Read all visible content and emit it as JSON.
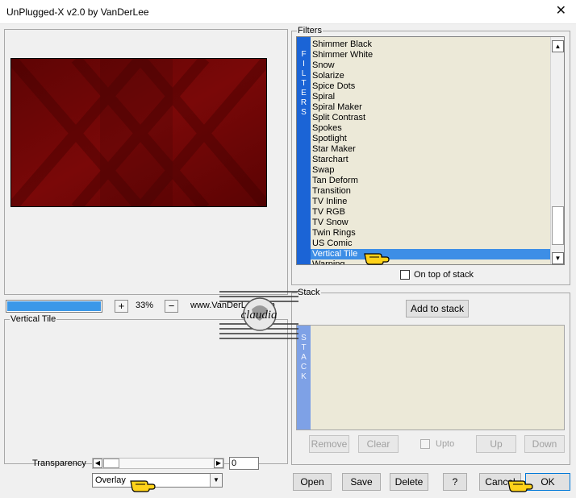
{
  "window": {
    "title": "UnPlugged-X v2.0 by VanDerLee",
    "close_glyph": "✕"
  },
  "preview": {
    "progress_percent": 100
  },
  "zoom": {
    "minus": "−",
    "plus": "+",
    "value": "33%"
  },
  "website": "www.VanDerLee.com",
  "filters": {
    "group_label": "Filters",
    "tab_text": "FILTERS",
    "items": [
      "Shimmer Black",
      "Shimmer White",
      "Snow",
      "Solarize",
      "Spice Dots",
      "Spiral",
      "Spiral Maker",
      "Split Contrast",
      "Spokes",
      "Spotlight",
      "Star Maker",
      "Starchart",
      "Swap",
      "Tan Deform",
      "Transition",
      "TV Inline",
      "TV RGB",
      "TV Snow",
      "Twin Rings",
      "US Comic",
      "Vertical Tile",
      "Warping"
    ],
    "selected_index": 20,
    "scroll_up_glyph": "▲",
    "scroll_down_glyph": "▼",
    "on_top_label": "On top of stack"
  },
  "settings": {
    "group_label": "Vertical Tile"
  },
  "stack": {
    "group_label": "Stack",
    "tab_text": "STACK",
    "add_button": "Add to stack",
    "remove": "Remove",
    "clear": "Clear",
    "upto": "Upto",
    "up": "Up",
    "down": "Down"
  },
  "transparency": {
    "label": "Transparency",
    "value": "0",
    "left_glyph": "◀",
    "right_glyph": "▶"
  },
  "blend": {
    "selected": "Overlay",
    "arrow_glyph": "▼"
  },
  "footer": {
    "open": "Open",
    "save": "Save",
    "delete": "Delete",
    "help": "?",
    "cancel": "Cancel",
    "ok": "OK"
  },
  "watermark": {
    "text": "claudia"
  },
  "colors": {
    "accent": "#3d8ee6",
    "filters_tab": "#1b64d6",
    "stack_tab": "#7ea1e6",
    "preview_red": "#6d0606",
    "hand": "#ffd21a"
  }
}
